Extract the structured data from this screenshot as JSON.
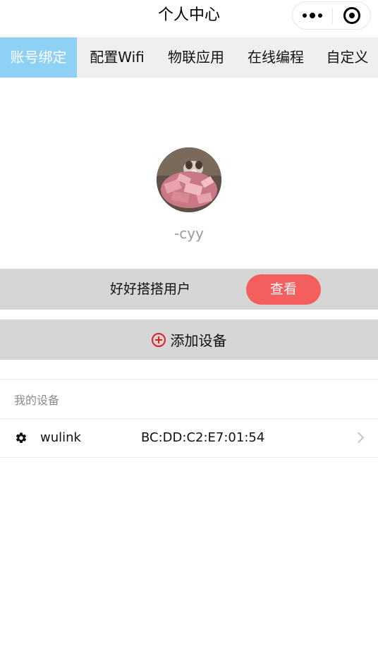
{
  "header": {
    "title": "个人中心",
    "menu_icon": "more-dots-icon",
    "close_icon": "target-close-icon"
  },
  "tabs": [
    {
      "label": "账号绑定",
      "active": true
    },
    {
      "label": "配置Wifi",
      "active": false
    },
    {
      "label": "物联应用",
      "active": false
    },
    {
      "label": "在线编程",
      "active": false
    },
    {
      "label": "自定义",
      "active": false
    }
  ],
  "profile": {
    "nickname": "-cyy"
  },
  "user_row": {
    "text": "好好搭搭用户",
    "button_label": "查看"
  },
  "add_device": {
    "label": "添加设备",
    "icon": "plus-circle-icon"
  },
  "devices": {
    "section_title": "我的设备",
    "items": [
      {
        "name": "wulink",
        "mac": "BC:DD:C2:E7:01:54",
        "icon": "gear-icon"
      }
    ]
  },
  "colors": {
    "tab_active_bg": "#8fd0f5",
    "tab_bar_bg": "#efefef",
    "row_bg": "#d6d6d6",
    "button_bg": "#f45f5d",
    "plus_icon": "#e02020"
  }
}
